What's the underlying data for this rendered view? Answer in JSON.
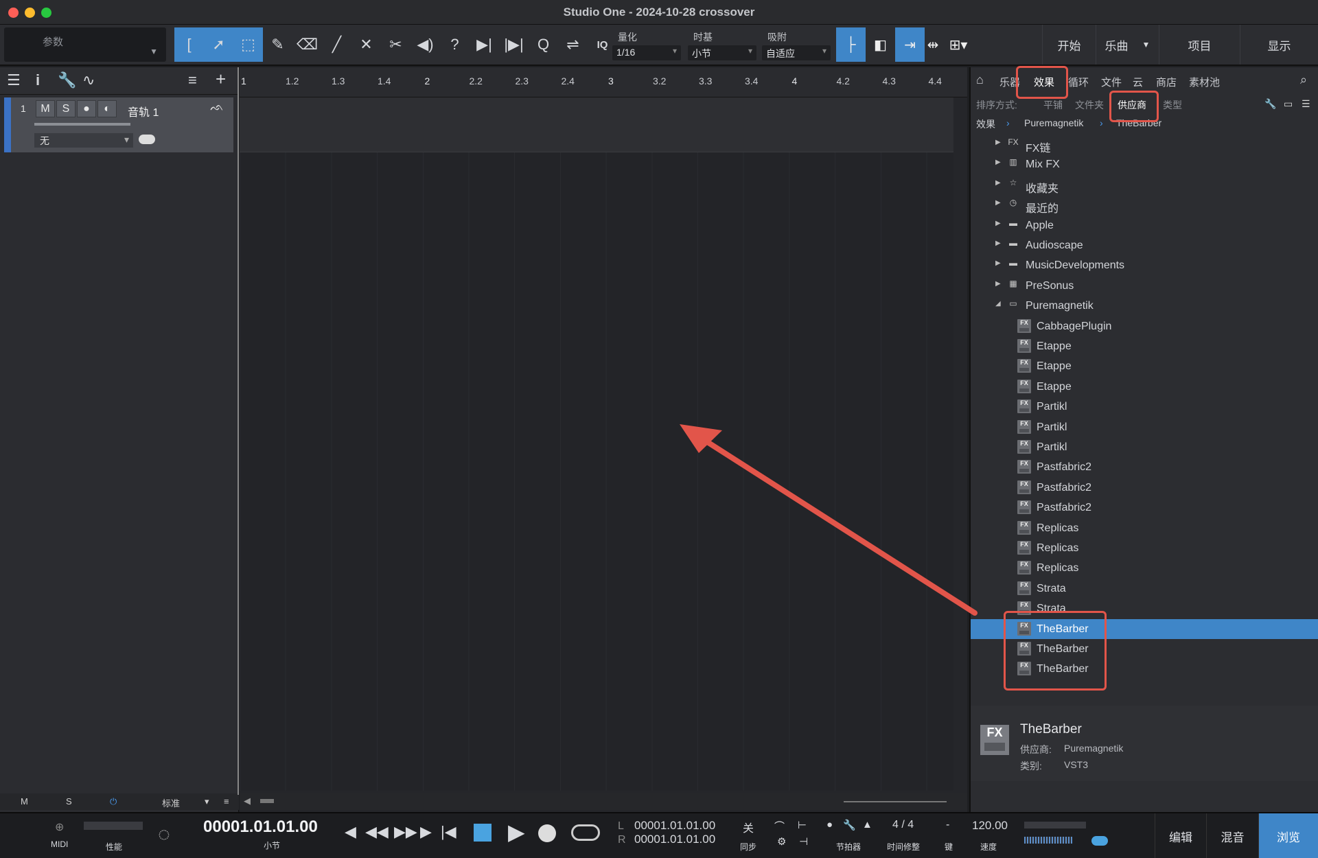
{
  "window": {
    "title": "Studio One - 2024-10-28 crossover"
  },
  "toolbar": {
    "context": "参数",
    "quantize": {
      "label": "量化",
      "value": "1/16"
    },
    "timebase": {
      "label": "时基",
      "value": "小节"
    },
    "snap": {
      "label": "吸附",
      "value": "自适应"
    },
    "iq": "IQ",
    "nav": {
      "start": "开始",
      "song": "乐曲",
      "project": "项目",
      "show": "显示"
    }
  },
  "track": {
    "number": "1",
    "mute": "M",
    "solo": "S",
    "name": "音轨 1",
    "input": "无"
  },
  "ruler": {
    "marks": [
      "1",
      "1.2",
      "1.3",
      "1.4",
      "2",
      "2.2",
      "2.3",
      "2.4",
      "3",
      "3.2",
      "3.3",
      "3.4",
      "4",
      "4.2",
      "4.3",
      "4.4"
    ]
  },
  "left_footer": {
    "m": "M",
    "s": "S",
    "mode": "标准"
  },
  "browser": {
    "tabs": {
      "instruments": "乐器",
      "effects": "效果",
      "loops": "循环",
      "files": "文件",
      "cloud": "云",
      "shop": "商店",
      "pool": "素材池"
    },
    "sort": {
      "label": "排序方式:",
      "flat": "平铺",
      "folder": "文件夹",
      "vendor": "供应商",
      "type": "类型"
    },
    "breadcrumb": {
      "root": "效果",
      "vendor": "Puremagnetik",
      "plugin": "TheBarber"
    },
    "folders": [
      {
        "label": "FX链",
        "icon": "fx-chain-icon"
      },
      {
        "label": "Mix FX",
        "icon": "mixfx-icon"
      },
      {
        "label": "收藏夹",
        "icon": "star-icon"
      },
      {
        "label": "最近的",
        "icon": "clock-icon"
      },
      {
        "label": "Apple",
        "icon": "folder-icon"
      },
      {
        "label": "Audioscape",
        "icon": "folder-icon"
      },
      {
        "label": "MusicDevelopments",
        "icon": "folder-icon"
      },
      {
        "label": "PreSonus",
        "icon": "presonus-icon"
      },
      {
        "label": "Puremagnetik",
        "icon": "folder-open-icon"
      }
    ],
    "plugins": [
      "CabbagePlugin",
      "Etappe",
      "Etappe",
      "Etappe",
      "Partikl",
      "Partikl",
      "Partikl",
      "Pastfabric2",
      "Pastfabric2",
      "Pastfabric2",
      "Replicas",
      "Replicas",
      "Replicas",
      "Strata",
      "Strata",
      "TheBarber",
      "TheBarber",
      "TheBarber"
    ],
    "fx_badge": "FX",
    "info": {
      "name": "TheBarber",
      "vendor_label": "供应商:",
      "vendor": "Puremagnetik",
      "type_label": "类别:",
      "type": "VST3"
    }
  },
  "transport": {
    "midi": "MIDI",
    "perf": "性能",
    "time": "00001.01.01.00",
    "time_unit": "小节",
    "loop_l_label": "L",
    "loop_l": "00001.01.01.00",
    "loop_r_label": "R",
    "loop_r": "00001.01.01.00",
    "sync_value": "关",
    "sync_label": "同步",
    "metronome": "节拍器",
    "signature": "4 / 4",
    "sig_label": "时间修整",
    "key_value": "-",
    "key_label": "键",
    "tempo": "120.00",
    "tempo_label": "速度",
    "panes": {
      "edit": "编辑",
      "mix": "混音",
      "browse": "浏览"
    }
  },
  "colors": {
    "accent": "#3f86c8",
    "annotation": "#e2554a"
  }
}
